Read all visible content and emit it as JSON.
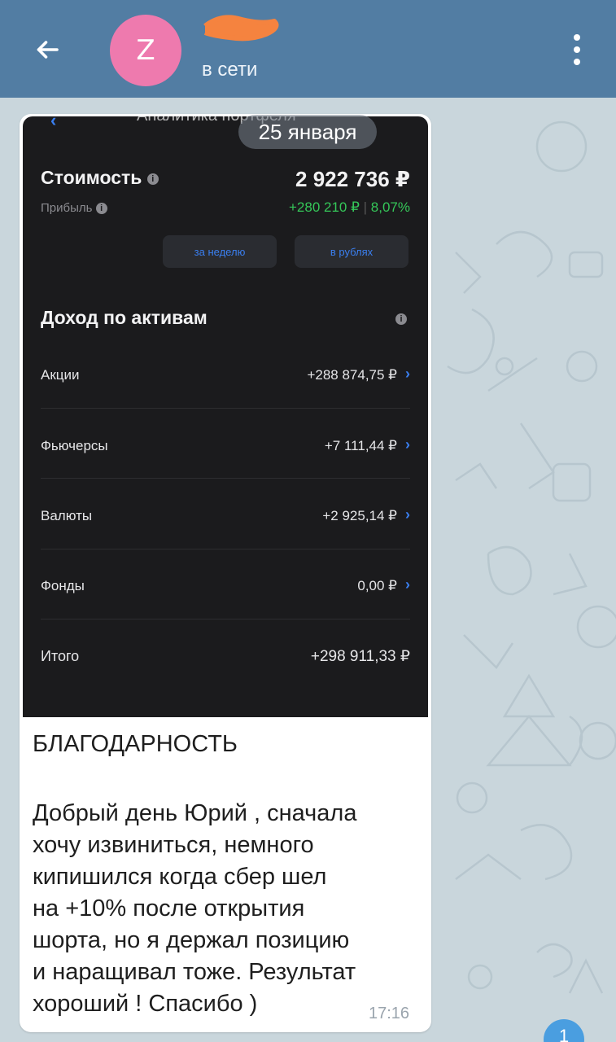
{
  "header": {
    "status": "в сети",
    "avatar_letter": "Z"
  },
  "message": {
    "date": "25 января",
    "photo": {
      "top_cut_title": "Аналитика портфеля",
      "value_label": "Стоимость",
      "value_amount": "2 922 736 ₽",
      "profit_label": "Прибыль",
      "profit_amount": "+280 210 ₽",
      "profit_percent": "8,07%",
      "period_button": "за неделю",
      "currency_button": "в рублях",
      "section_title": "Доход по активам",
      "rows": [
        {
          "label": "Акции",
          "value": "+288 874,75 ₽"
        },
        {
          "label": "Фьючерсы",
          "value": "+7 111,44 ₽"
        },
        {
          "label": "Валюты",
          "value": "+2 925,14 ₽"
        },
        {
          "label": "Фонды",
          "value": "0,00 ₽"
        }
      ],
      "total_label": "Итого",
      "total_value": "+298 911,33 ₽"
    },
    "title": "БЛАГОДАРНОСТЬ",
    "body_lines": [
      "Добрый день Юрий , сначала",
      "хочу извиниться, немного",
      "кипишился когда сбер шел",
      "на +10% после открытия",
      "шорта, но я держал позицию",
      "и наращивал тоже. Результат",
      "хороший ! Спасибо )"
    ],
    "time": "17:16"
  },
  "unread_count": "1",
  "colors": {
    "header": "#527da3",
    "avatar": "#ee7aae",
    "profit": "#35c759",
    "accent": "#3a7ff0",
    "photo_bg": "#1b1b1d"
  }
}
